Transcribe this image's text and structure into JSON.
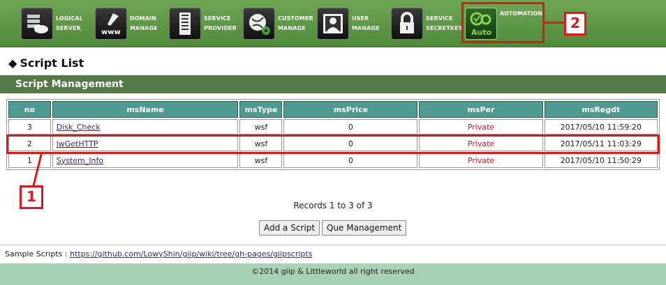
{
  "nav": {
    "items": [
      {
        "label": "LOGICAL\nSERVER",
        "icon": "server-cloud-icon"
      },
      {
        "label": "DOMAIN\nMANAGE",
        "icon": "www-brush-icon"
      },
      {
        "label": "SERVICE\nPROVIDER",
        "icon": "building-icon"
      },
      {
        "label": "CUSTOMER\nMANAGE",
        "icon": "globe-gear-icon"
      },
      {
        "label": "USER\nMANAGE",
        "icon": "user-portrait-icon"
      },
      {
        "label": "SERVICE\nSECRETKEY",
        "icon": "padlock-icon"
      },
      {
        "label": "AUTOMATION",
        "icon": "automation-gears-icon",
        "icon_text": "Auto"
      }
    ]
  },
  "annotations": {
    "badge1": "1",
    "badge2": "2",
    "color": "#e0161d"
  },
  "page": {
    "title": "Script List",
    "section": "Script Management"
  },
  "table": {
    "columns": [
      "no",
      "msName",
      "msType",
      "msPrice",
      "msPer",
      "msRegdt"
    ],
    "rows": [
      {
        "no": "3",
        "msName": "Disk_Check",
        "msType": "wsf",
        "msPrice": "0",
        "msPer": "Private",
        "msRegdt": "2017/05/10 11:59:20"
      },
      {
        "no": "2",
        "msName": "lwGetHTTP",
        "msType": "wsf",
        "msPrice": "0",
        "msPer": "Private",
        "msRegdt": "2017/05/11 11:03:29"
      },
      {
        "no": "1",
        "msName": "System_Info",
        "msType": "wsf",
        "msPrice": "0",
        "msPer": "Private",
        "msRegdt": "2017/05/10 11:50:29"
      }
    ]
  },
  "records": "Records 1 to 3 of 3",
  "buttons": {
    "add": "Add a Script",
    "que": "Que Management"
  },
  "sample": {
    "label": "Sample Scripts :",
    "link": "https://github.com/LowyShin/giip/wiki/tree/gh-pages/giipscripts"
  },
  "footer": "©2014 giip & Littleworld all right reserved",
  "colors": {
    "nav_green": "#5d9a46",
    "header_teal": "#4e9a91",
    "section_green": "#56794a",
    "footer_green": "#a7d1b4",
    "private_red": "#cc2222"
  }
}
